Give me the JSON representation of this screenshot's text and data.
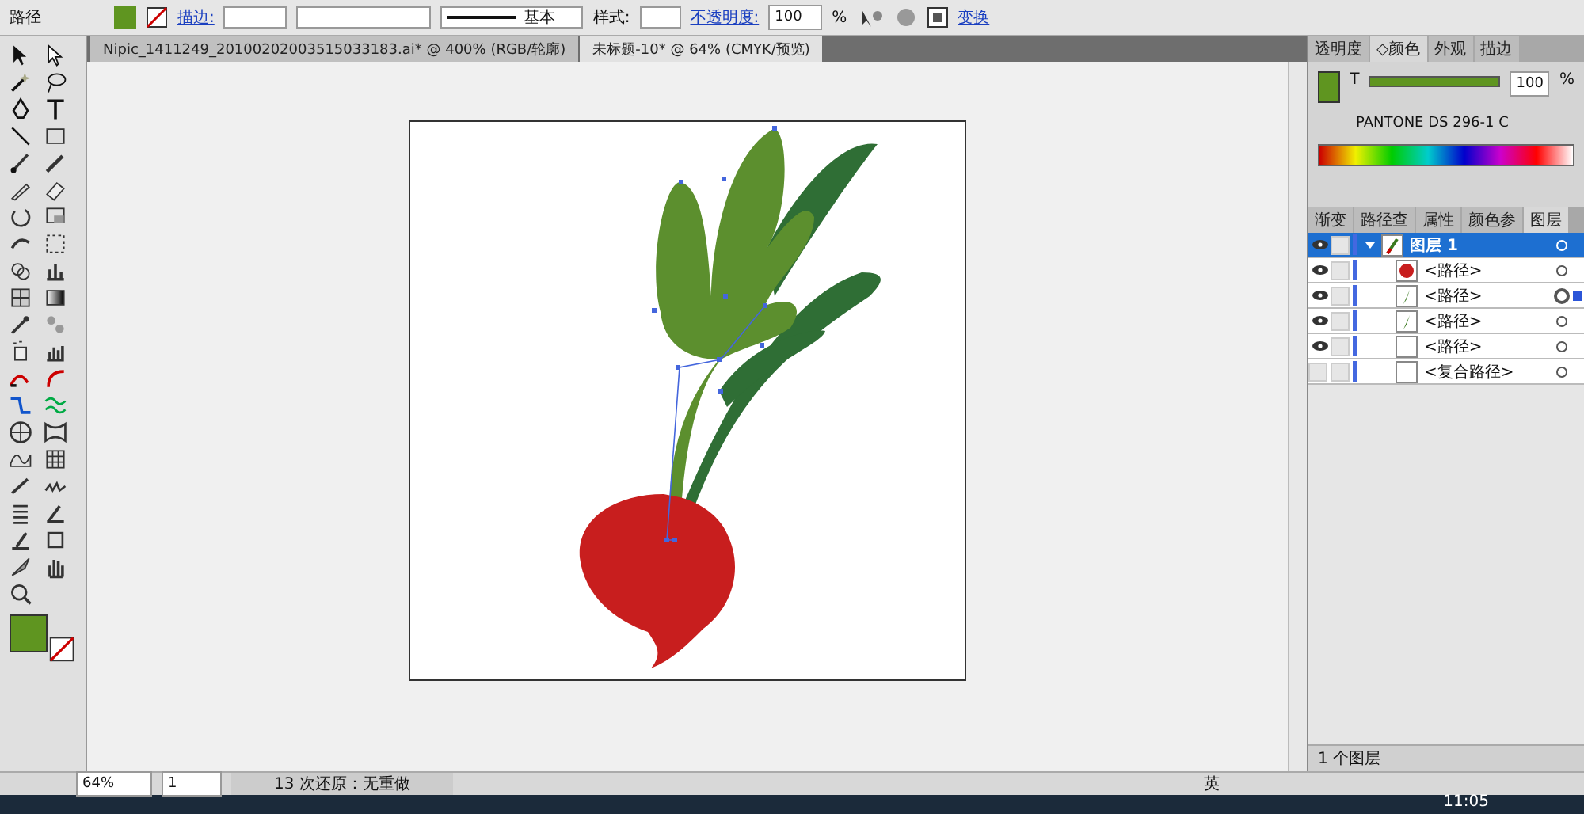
{
  "control_bar": {
    "object_type": "路径",
    "stroke_label": "描边:",
    "stroke_profile": "基本",
    "style_label": "样式:",
    "opacity_label": "不透明度:",
    "opacity_value": "100",
    "opacity_unit": "%",
    "transform_link": "变换"
  },
  "document_tabs": [
    {
      "title": "Nipic_1411249_20100202003515033183.ai* @ 400% (RGB/轮廓)",
      "selected": false
    },
    {
      "title": "未标题-10* @ 64% (CMYK/预览)",
      "selected": true
    }
  ],
  "color_panel": {
    "tabs": [
      {
        "label": "透明度",
        "selected": false
      },
      {
        "label": "◇颜色",
        "selected": true
      },
      {
        "label": "外观",
        "selected": false
      },
      {
        "label": "描边",
        "selected": false
      }
    ],
    "tint_label": "T",
    "tint": {
      "level": 1.0
    },
    "tint_value": "100",
    "tint_unit": "%",
    "swatch_name": "PANTONE DS 296-1 C"
  },
  "layers_panel": {
    "tabs": [
      {
        "label": "渐变",
        "selected": false
      },
      {
        "label": "路径查",
        "selected": false
      },
      {
        "label": "属性",
        "selected": false
      },
      {
        "label": "颜色参",
        "selected": false
      },
      {
        "label": "图层",
        "selected": true
      }
    ],
    "layers": [
      {
        "name": "图层 1",
        "kind": "layer",
        "visible": true,
        "selected": true,
        "targeted": false,
        "children": [
          {
            "name": "<路径>",
            "kind": "radish",
            "visible": true,
            "selected": false,
            "targeted": false
          },
          {
            "name": "<路径>",
            "kind": "leaf",
            "visible": true,
            "selected": false,
            "targeted": true
          },
          {
            "name": "<路径>",
            "kind": "leaf",
            "visible": true,
            "selected": false,
            "targeted": false
          },
          {
            "name": "<路径>",
            "kind": "empty",
            "visible": true,
            "selected": false,
            "targeted": false
          },
          {
            "name": "<复合路径>",
            "kind": "empty",
            "visible": false,
            "selected": false,
            "targeted": false
          }
        ]
      }
    ],
    "layer_count": "1 个图层"
  },
  "status_bar": {
    "zoom": "64%",
    "artboard": "1",
    "history": "13 次还原：无重做",
    "ime_language": "英"
  },
  "taskbar": {
    "clock": "11:05"
  }
}
